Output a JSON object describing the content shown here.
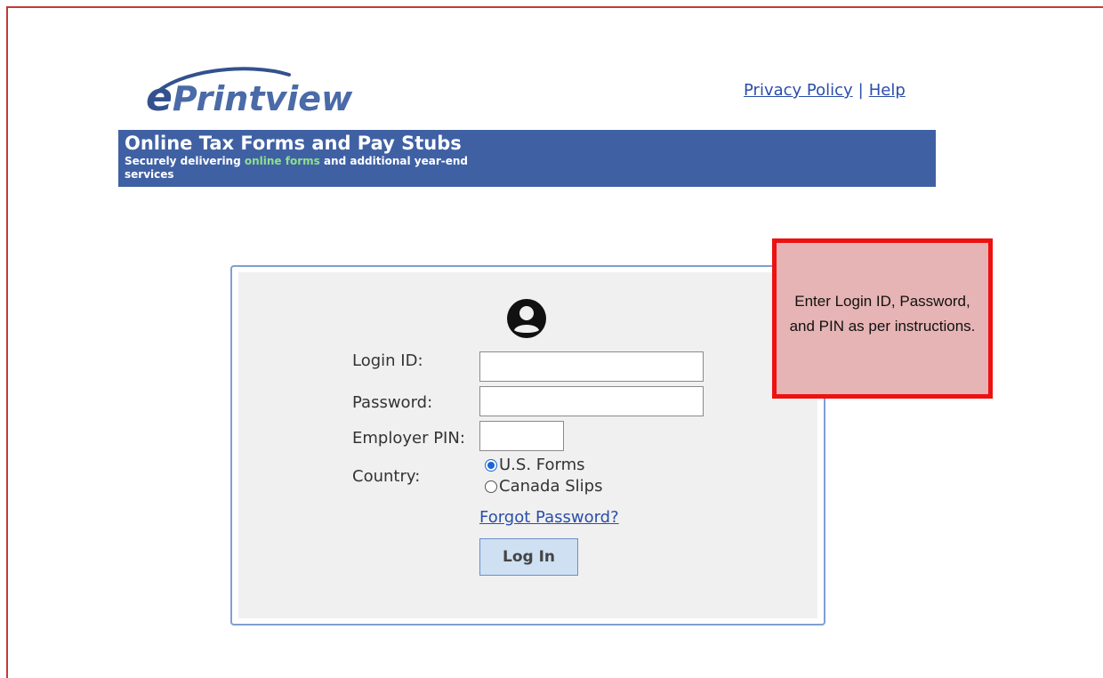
{
  "logo": {
    "text": "Printview",
    "e_letter": "e"
  },
  "header_links": {
    "privacy_policy": "Privacy Policy",
    "separator": "|",
    "help": "Help"
  },
  "banner": {
    "title": "Online Tax Forms and Pay Stubs",
    "subtitle_before": "Securely delivering ",
    "subtitle_highlight": "online forms",
    "subtitle_after": " and additional year-end services"
  },
  "login_form": {
    "login_id_label": "Login ID:",
    "login_id_value": "",
    "password_label": "Password:",
    "password_value": "",
    "employer_pin_label": "Employer PIN:",
    "employer_pin_value": "",
    "country_label": "Country:",
    "country_options": [
      "U.S. Forms",
      "Canada Slips"
    ],
    "country_selected": "U.S. Forms",
    "forgot_password": "Forgot Password?",
    "login_button": "Log In"
  },
  "callout": {
    "text": "Enter Login ID, Password, and PIN as per instructions."
  },
  "colors": {
    "banner_bg": "#3f61a4",
    "banner_highlight": "#8fe08a",
    "link": "#2a4ea8",
    "callout_border": "#ee1111",
    "callout_bg": "#e6b4b4",
    "login_box_border": "#7f9fd0",
    "button_bg": "#cfe0f3"
  },
  "icons": {
    "user": "user-circle-icon",
    "logo_swoosh": "logo-swoosh-icon"
  }
}
